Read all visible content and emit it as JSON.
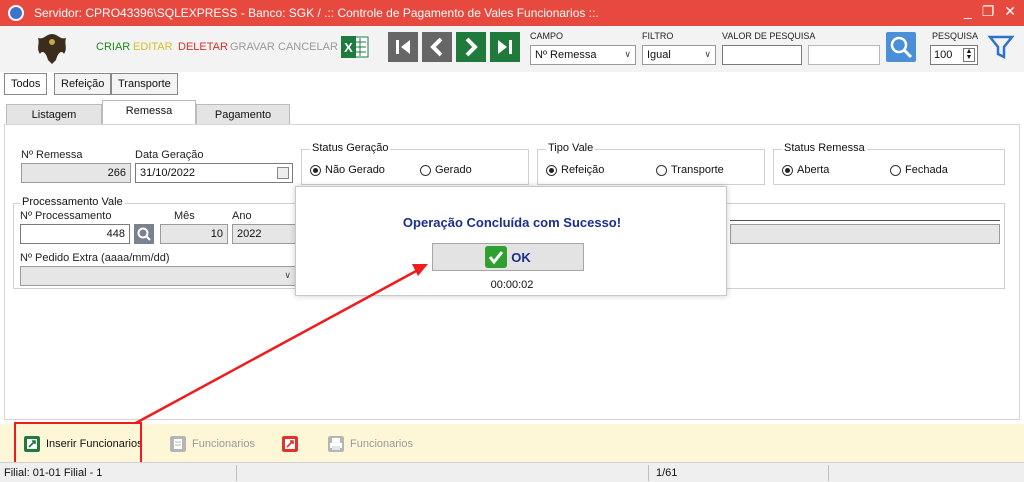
{
  "window": {
    "title": "Servidor: CPRO43396\\SQLEXPRESS - Banco: SGK / .:: Controle de Pagamento de Vales Funcionarios ::.",
    "minimize": "_",
    "restore": "❐",
    "close": "✕"
  },
  "toolbar": {
    "criar": "CRIAR",
    "editar": "EDITAR",
    "deletar": "DELETAR",
    "gravar": "GRAVAR",
    "cancelar": "CANCELAR",
    "excel_label": "X",
    "campo_label": "CAMPO",
    "campo_value": "Nº Remessa",
    "filtro_label": "FILTRO",
    "filtro_value": "Igual",
    "valor_label": "VALOR DE PESQUISA",
    "valor_value": "",
    "pesquisa_label": "PESQUISA",
    "pesquisa_value": "100"
  },
  "top_tabs": [
    "Todos",
    "Refeição",
    "Transporte"
  ],
  "sub_tabs": [
    "Listagem",
    "Remessa",
    "Pagamento"
  ],
  "form": {
    "remessa_label": "Nº Remessa",
    "remessa_value": "266",
    "data_label": "Data Geração",
    "data_value": "31/10/2022",
    "status_geracao": {
      "legend": "Status Geração",
      "opt1": "Não Gerado",
      "opt2": "Gerado"
    },
    "tipo_vale": {
      "legend": "Tipo Vale",
      "opt1": "Refeição",
      "opt2": "Transporte"
    },
    "status_remessa": {
      "legend": "Status Remessa",
      "opt1": "Aberta",
      "opt2": "Fechada"
    },
    "processamento": {
      "legend": "Processamento Vale",
      "num_label": "Nº Processamento",
      "num_value": "448",
      "mes_label": "Mês",
      "mes_value": "10",
      "ano_label": "Ano",
      "ano_value": "2022",
      "pedido_label": "Nº Pedido Extra (aaaa/mm/dd)",
      "pedido_value": ""
    }
  },
  "dialog": {
    "message": "Operação Concluída com Sucesso!",
    "ok_label": "OK",
    "timer": "00:00:02"
  },
  "bottom": {
    "inserir": "Inserir Funcionarios",
    "funcionarios1": "Funcionarios",
    "funcionarios2": "Funcionarios"
  },
  "status": {
    "filial": "Filial: 01-01 Filial - 1",
    "page": "1/61"
  },
  "colors": {
    "titlebar": "#e8493f",
    "criar": "#1f8a1f",
    "editar": "#d6c22a",
    "deletar": "#d9302a",
    "disabled": "#9a9a9a",
    "dialog_text": "#1b2f8a",
    "highlight": "#ee1c1c",
    "bottombar": "#fdf7d8"
  }
}
